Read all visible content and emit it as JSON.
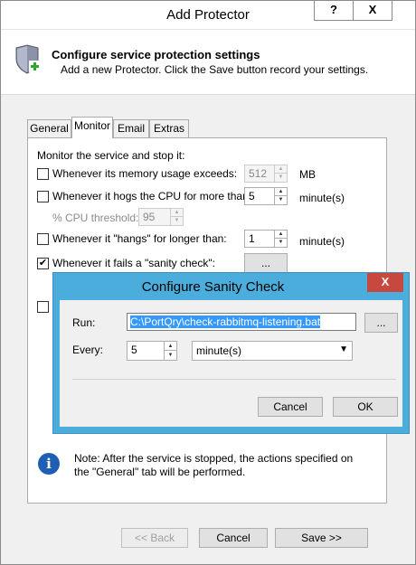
{
  "window": {
    "title": "Add Protector",
    "help_label": "?",
    "close_label": "X"
  },
  "header": {
    "title": "Configure service protection settings",
    "subtitle": "Add a new Protector. Click the Save button record your settings."
  },
  "tabs": [
    {
      "label": "General"
    },
    {
      "label": "Monitor"
    },
    {
      "label": "Email"
    },
    {
      "label": "Extras"
    }
  ],
  "monitor": {
    "intro": "Monitor the service and stop it:",
    "memory": {
      "label": "Whenever its memory usage exceeds:",
      "value": "512",
      "unit": "MB",
      "checked": false
    },
    "cpu": {
      "label": "Whenever it hogs the CPU for more than:",
      "value": "5",
      "unit": "minute(s)",
      "checked": false
    },
    "cpu_threshold": {
      "label": "% CPU threshold:",
      "value": "95"
    },
    "hangs": {
      "label": "Whenever it \"hangs\" for longer than:",
      "value": "1",
      "unit": "minute(s)",
      "checked": false
    },
    "sanity": {
      "label": "Whenever it fails a \"sanity check\":",
      "button_label": "...",
      "checked": true
    },
    "extra_checkbox": {
      "checked": false
    }
  },
  "note": {
    "icon_glyph": "i",
    "text": "Note: After the service is stopped, the actions specified on the \"General\" tab will be performed."
  },
  "footer": {
    "back_label": "<< Back",
    "cancel_label": "Cancel",
    "save_label": "Save >>"
  },
  "sanity_dialog": {
    "title": "Configure Sanity Check",
    "close_label": "X",
    "run_label": "Run:",
    "run_value": "C:\\PortQry\\check-rabbitmq-listening.bat",
    "browse_label": "...",
    "every_label": "Every:",
    "every_value": "5",
    "interval_unit": "minute(s)",
    "cancel_label": "Cancel",
    "ok_label": "OK"
  }
}
